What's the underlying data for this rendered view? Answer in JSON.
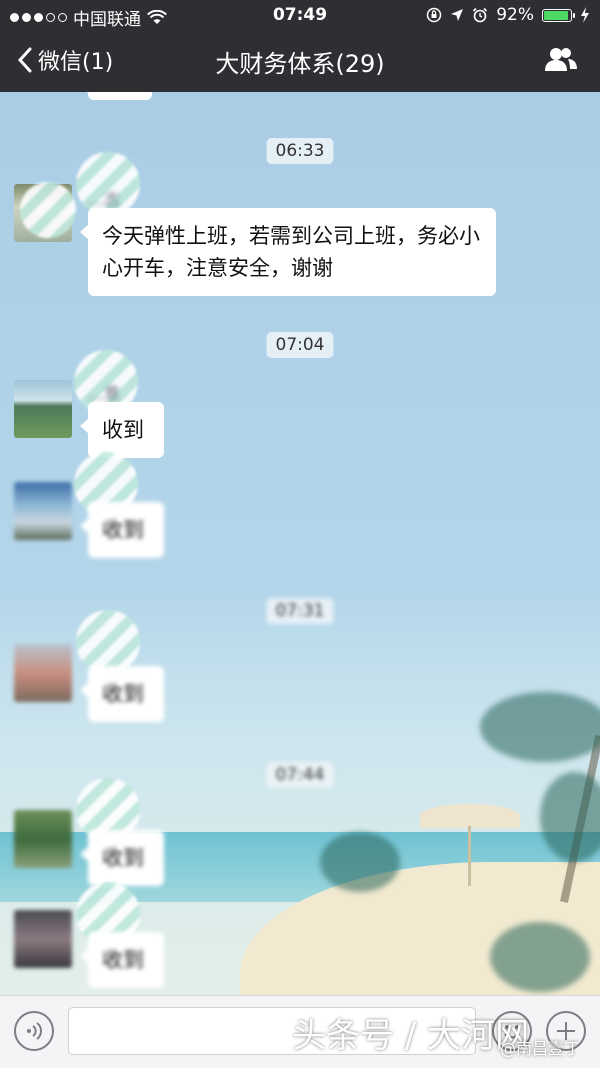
{
  "status_bar": {
    "carrier": "中国联通",
    "time": "07:49",
    "battery_percent": "92%",
    "battery_level": 0.92,
    "battery_color": "#4cd964"
  },
  "nav": {
    "back_label": "微信(1)",
    "title": "大财务体系(29)",
    "group_icon": "people-icon"
  },
  "chat": {
    "top_partial_bubble": "",
    "timestamps": [
      "06:33",
      "07:04",
      "07:31",
      "07:44"
    ],
    "messages": [
      {
        "sender": "…志",
        "text": "今天弹性上班，若需到公司上班，务必小心开车，注意安全，谢谢"
      },
      {
        "sender": "…意",
        "text": "收到"
      },
      {
        "sender": "",
        "text": "收到"
      },
      {
        "sender": "",
        "text": "收到"
      },
      {
        "sender": "",
        "text": "收到"
      },
      {
        "sender": "",
        "text": "收到"
      }
    ]
  },
  "input_bar": {
    "voice_icon": "voice-icon",
    "emoji_icon": "emoji-icon",
    "plus_icon": "plus-icon"
  },
  "watermark": {
    "main": "头条号 / 大河网",
    "sub": "@南昌壹丁"
  },
  "colors": {
    "nav_bg": "#2e2f33",
    "chat_bg": "#a9cfe6",
    "bubble_bg": "#ffffff"
  }
}
